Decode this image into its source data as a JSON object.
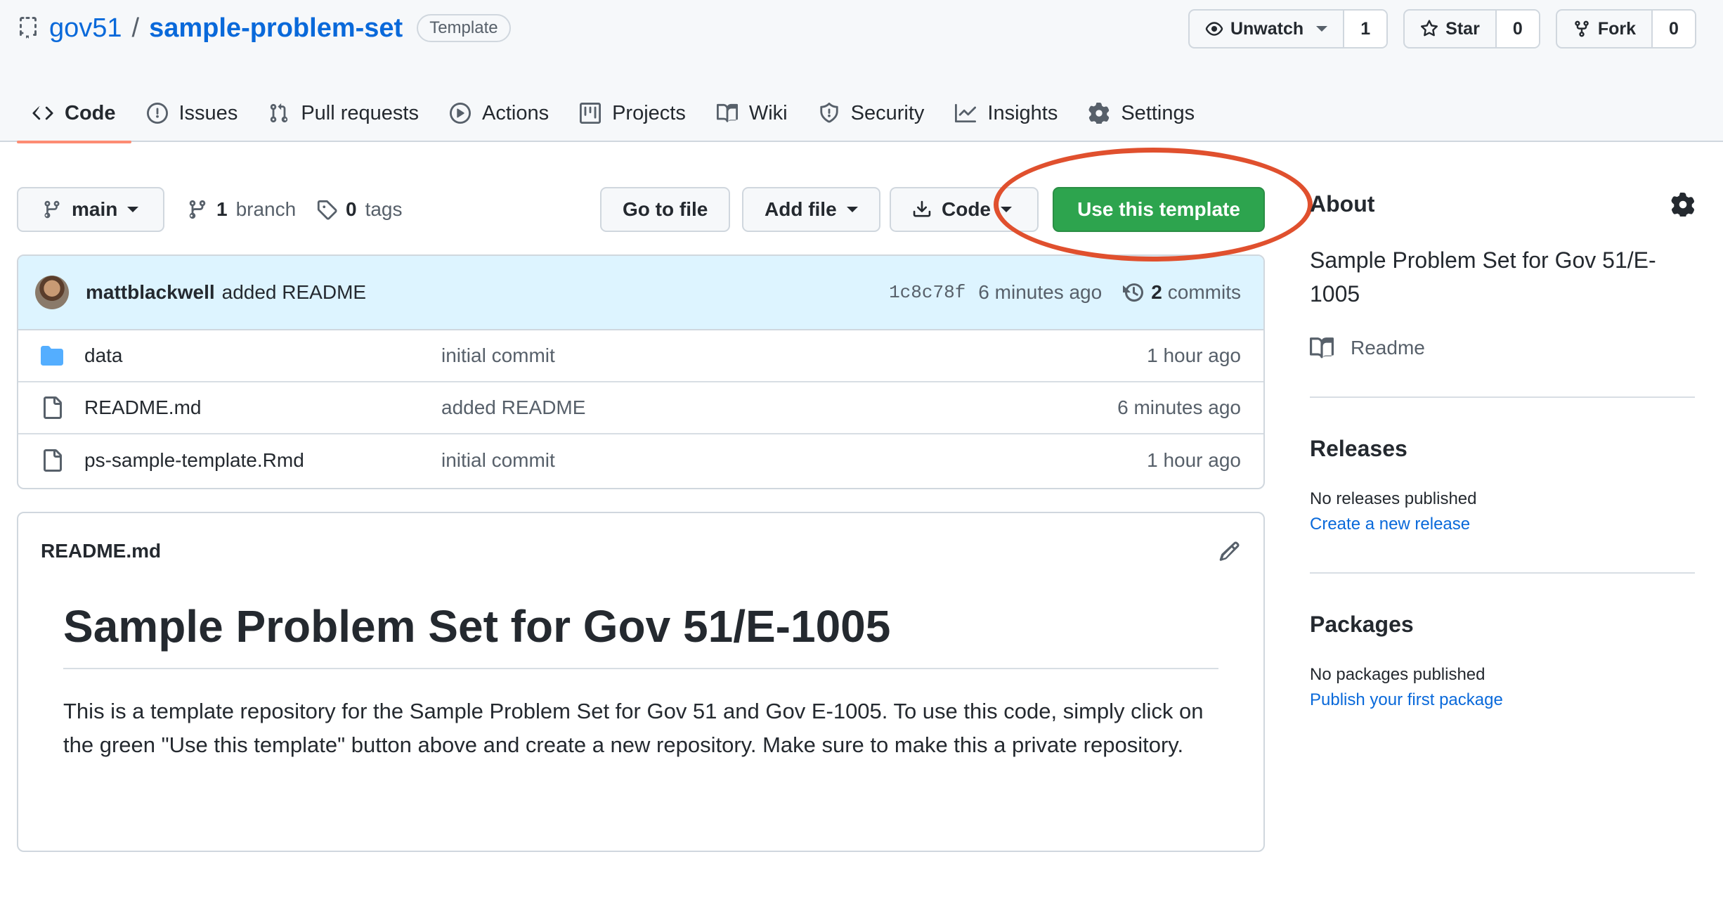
{
  "repo": {
    "owner": "gov51",
    "separator": "/",
    "name": "sample-problem-set",
    "badge": "Template"
  },
  "actions": {
    "watch": {
      "label": "Unwatch",
      "count": "1"
    },
    "star": {
      "label": "Star",
      "count": "0"
    },
    "fork": {
      "label": "Fork",
      "count": "0"
    }
  },
  "tabs": [
    {
      "label": "Code",
      "icon": "code-icon",
      "active": true
    },
    {
      "label": "Issues",
      "icon": "issue-icon"
    },
    {
      "label": "Pull requests",
      "icon": "pull-request-icon"
    },
    {
      "label": "Actions",
      "icon": "play-icon"
    },
    {
      "label": "Projects",
      "icon": "project-icon"
    },
    {
      "label": "Wiki",
      "icon": "book-icon"
    },
    {
      "label": "Security",
      "icon": "shield-icon"
    },
    {
      "label": "Insights",
      "icon": "graph-icon"
    },
    {
      "label": "Settings",
      "icon": "gear-icon"
    }
  ],
  "toolbar": {
    "branch": "main",
    "branches_count": "1",
    "branches_label": "branch",
    "tags_count": "0",
    "tags_label": "tags",
    "go_to_file": "Go to file",
    "add_file": "Add file",
    "code": "Code",
    "use_template": "Use this template"
  },
  "latest_commit": {
    "author": "mattblackwell",
    "message": "added README",
    "sha": "1c8c78f",
    "age": "6 minutes ago",
    "commits_count": "2",
    "commits_label": "commits"
  },
  "files": [
    {
      "type": "folder",
      "name": "data",
      "message": "initial commit",
      "age": "1 hour ago"
    },
    {
      "type": "file",
      "name": "README.md",
      "message": "added README",
      "age": "6 minutes ago"
    },
    {
      "type": "file",
      "name": "ps-sample-template.Rmd",
      "message": "initial commit",
      "age": "1 hour ago"
    }
  ],
  "readme": {
    "filename": "README.md",
    "heading": "Sample Problem Set for Gov 51/E-1005",
    "paragraph": "This is a template repository for the Sample Problem Set for Gov 51 and Gov E-1005. To use this code, simply click on the green \"Use this template\" button above and create a new repository. Make sure to make this a private repository."
  },
  "sidebar": {
    "about_title": "About",
    "description": "Sample Problem Set for Gov 51/E-1005",
    "readme_label": "Readme",
    "releases_title": "Releases",
    "releases_text": "No releases published",
    "releases_link": "Create a new release",
    "packages_title": "Packages",
    "packages_text": "No packages published",
    "packages_link": "Publish your first package"
  },
  "colors": {
    "link": "#0969da",
    "primary_button": "#2da44e",
    "active_tab_underline": "#fd8c73",
    "annotation_ellipse": "#e0502e",
    "commit_bar": "#ddf4ff"
  }
}
